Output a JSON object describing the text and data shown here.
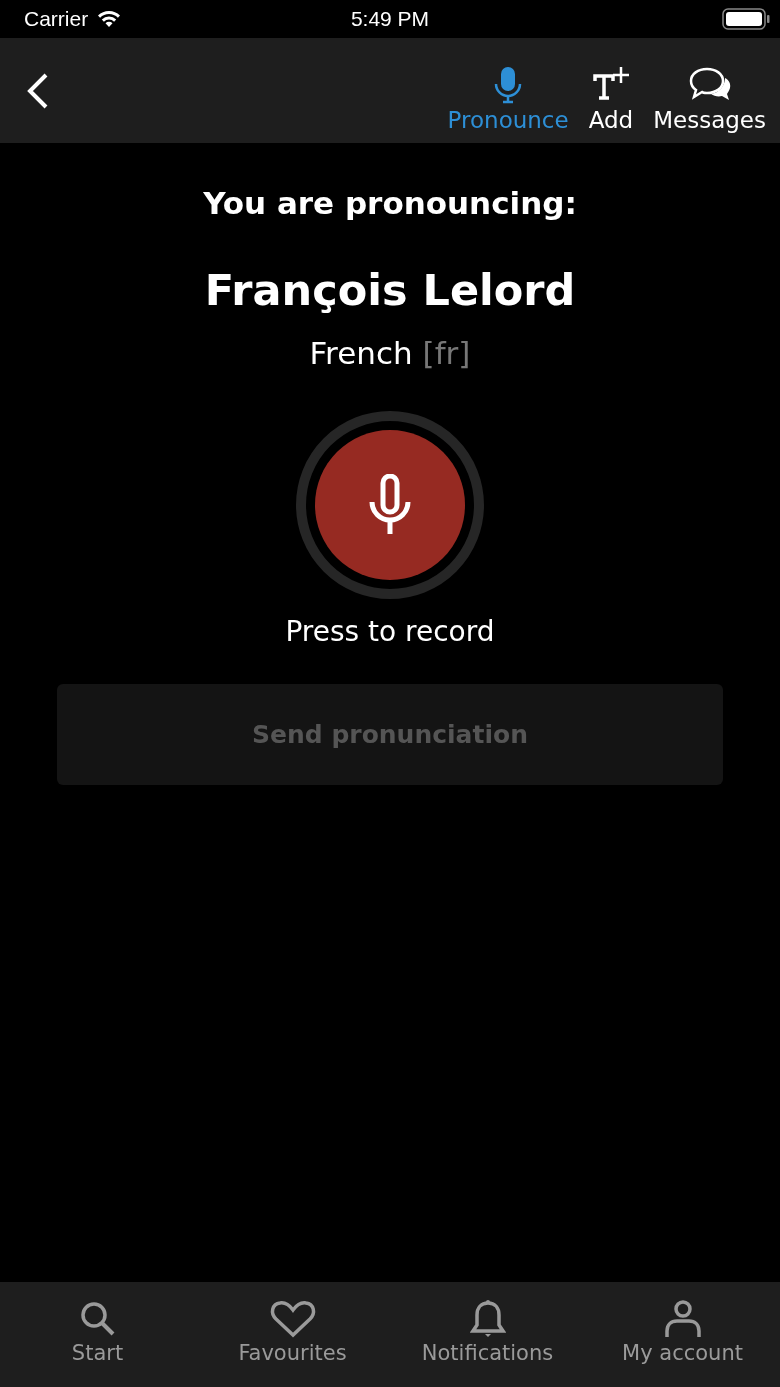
{
  "status_bar": {
    "carrier": "Carrier",
    "time": "5:49 PM"
  },
  "toolbar": {
    "actions": [
      {
        "kind": "mic",
        "label": "Pronounce",
        "selected": true
      },
      {
        "kind": "add",
        "label": "Add",
        "selected": false
      },
      {
        "kind": "messages",
        "label": "Messages",
        "selected": false
      }
    ]
  },
  "heading": "You are pronouncing:",
  "name": "François Lelord",
  "language": {
    "name": "French",
    "code": "[fr]"
  },
  "record": {
    "label": "Press to record"
  },
  "send_button": {
    "label": "Send pronunciation",
    "disabled": true
  },
  "tab_bar": [
    {
      "kind": "search",
      "label": "Start",
      "selected": false
    },
    {
      "kind": "heart",
      "label": "Favourites",
      "selected": false
    },
    {
      "kind": "bell",
      "label": "Notifications",
      "selected": false
    },
    {
      "kind": "person",
      "label": "My account",
      "selected": false
    }
  ]
}
